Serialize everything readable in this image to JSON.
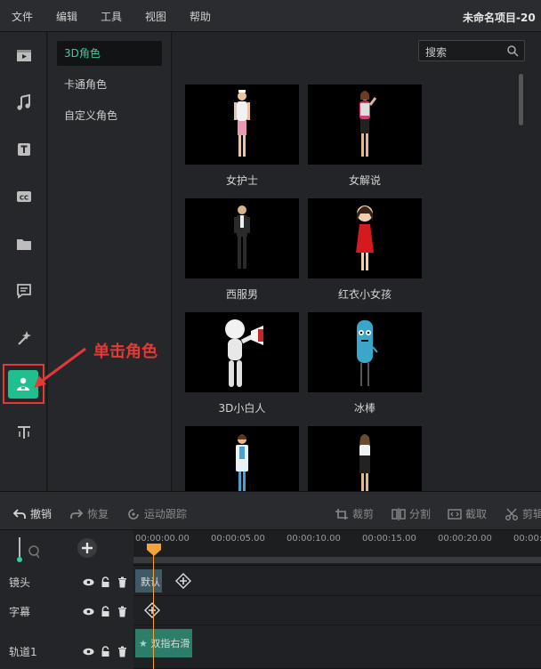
{
  "menu": {
    "items": [
      "文件",
      "编辑",
      "工具",
      "视图",
      "帮助"
    ],
    "project_title": "未命名项目-20"
  },
  "sidebar": {
    "categories": [
      {
        "label": "3D角色",
        "active": true
      },
      {
        "label": "卡通角色",
        "active": false
      },
      {
        "label": "自定义角色",
        "active": false
      }
    ]
  },
  "search": {
    "placeholder": "搜索"
  },
  "characters": [
    {
      "name": "女护士"
    },
    {
      "name": "女解说"
    },
    {
      "name": "西服男"
    },
    {
      "name": "红衣小女孩"
    },
    {
      "name": "3D小白人"
    },
    {
      "name": "冰棒"
    },
    {
      "name": ""
    },
    {
      "name": ""
    }
  ],
  "annotation": {
    "text": "单击角色",
    "color": "#e53935"
  },
  "toolbar": {
    "undo": "撤销",
    "redo": "恢复",
    "motion_track": "运动跟踪",
    "crop": "裁剪",
    "split": "分割",
    "trim": "截取",
    "cut": "剪辑"
  },
  "timeline": {
    "ticks": [
      "00:00:00.00",
      "00:00:05.00",
      "00:00:10.00",
      "00:00:15.00",
      "00:00:20.00",
      "00:00:2"
    ],
    "tracks": [
      {
        "label": "镜头",
        "clip": "默认"
      },
      {
        "label": "字幕",
        "clip": ""
      },
      {
        "label": "轨道1",
        "clip": "双指右滑"
      }
    ]
  },
  "colors": {
    "accent": "#2fd29a",
    "active_tile": "#1fbf8f",
    "playhead": "#f3a33a",
    "highlight": "#e53935"
  }
}
